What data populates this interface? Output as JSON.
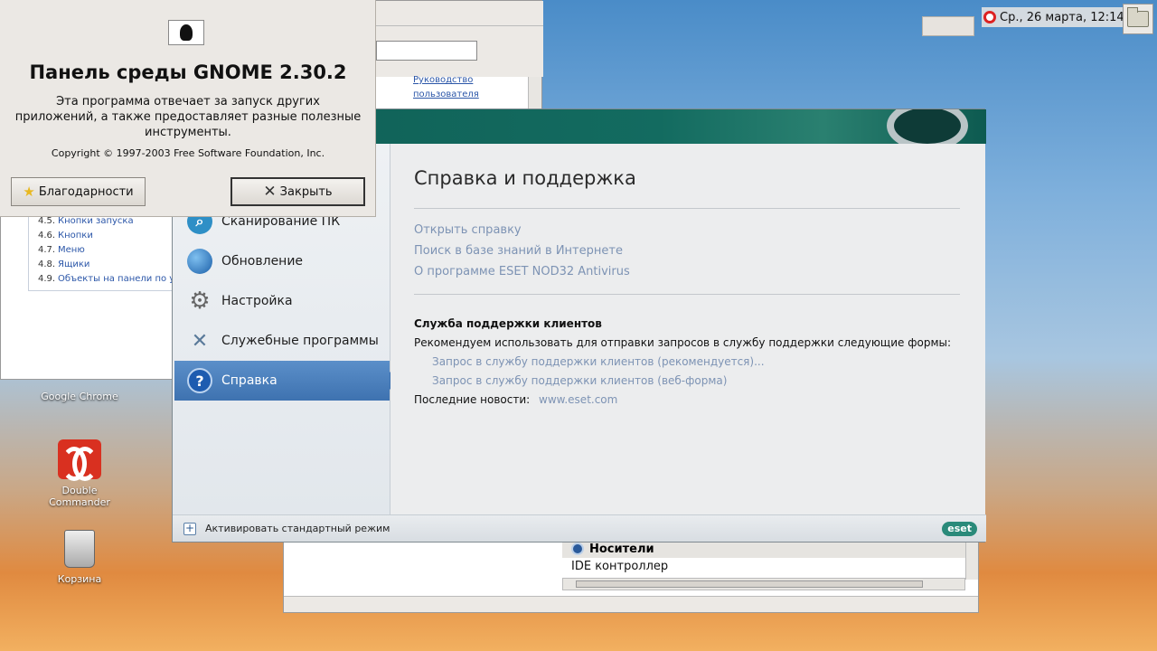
{
  "panel": {
    "datetime": "Ср., 26 марта, 12:14"
  },
  "about_dialog": {
    "title": "Панель среды GNOME 2.30.2",
    "description_line1": "Эта программа отвечает за запуск других",
    "description_line2": "приложений, а также предоставляет разные полезные",
    "description_line3": "инструменты.",
    "copyright": "Copyright © 1997-2003 Free Software Foundation, Inc.",
    "credits_label": "Благодарности",
    "close_label": "Закрыть"
  },
  "help_window": {
    "link_user_guide_line1": "Руководство",
    "link_user_guide_line2": "пользователя",
    "toc": [
      {
        "num": "4.5.",
        "text": "Кнопки запуска"
      },
      {
        "num": "4.6.",
        "text": "Кнопки"
      },
      {
        "num": "4.7.",
        "text": "Меню"
      },
      {
        "num": "4.8.",
        "text": "Ящики"
      },
      {
        "num": "4.9.",
        "text": "Объекты на панели по ум"
      }
    ]
  },
  "desktop_icons": {
    "chrome": "Google Chrome",
    "double_commander": "Double Commander",
    "trash": "Корзина"
  },
  "eset": {
    "sidebar": [
      {
        "label": "Сканирование ПК",
        "icon": "scan-icon"
      },
      {
        "label": "Обновление",
        "icon": "update-icon"
      },
      {
        "label": "Настройка",
        "icon": "settings-icon"
      },
      {
        "label": "Служебные программы",
        "icon": "tools-icon"
      },
      {
        "label": "Справка",
        "icon": "help-icon"
      }
    ],
    "title": "Справка и поддержка",
    "links": {
      "open_help": "Открыть справку",
      "kb_search": "Поиск в базе знаний в Интернете",
      "about": "О программе ESET NOD32 Antivirus"
    },
    "support_heading": "Служба поддержки клиентов",
    "support_text": "Рекомендуем использовать для отправки запросов в службу поддержки следующие формы:",
    "support_link1": "Запрос в службу поддержки клиентов (рекомендуется)...",
    "support_link2": "Запрос в службу поддержки клиентов (веб-форма)",
    "news_label": "Последние новости:",
    "news_link": "www.eset.com",
    "footer_label": "Активировать стандартный режим",
    "logo_text": "eset"
  },
  "doc_window": {
    "section": "Носители",
    "item": "IDE контроллер"
  }
}
